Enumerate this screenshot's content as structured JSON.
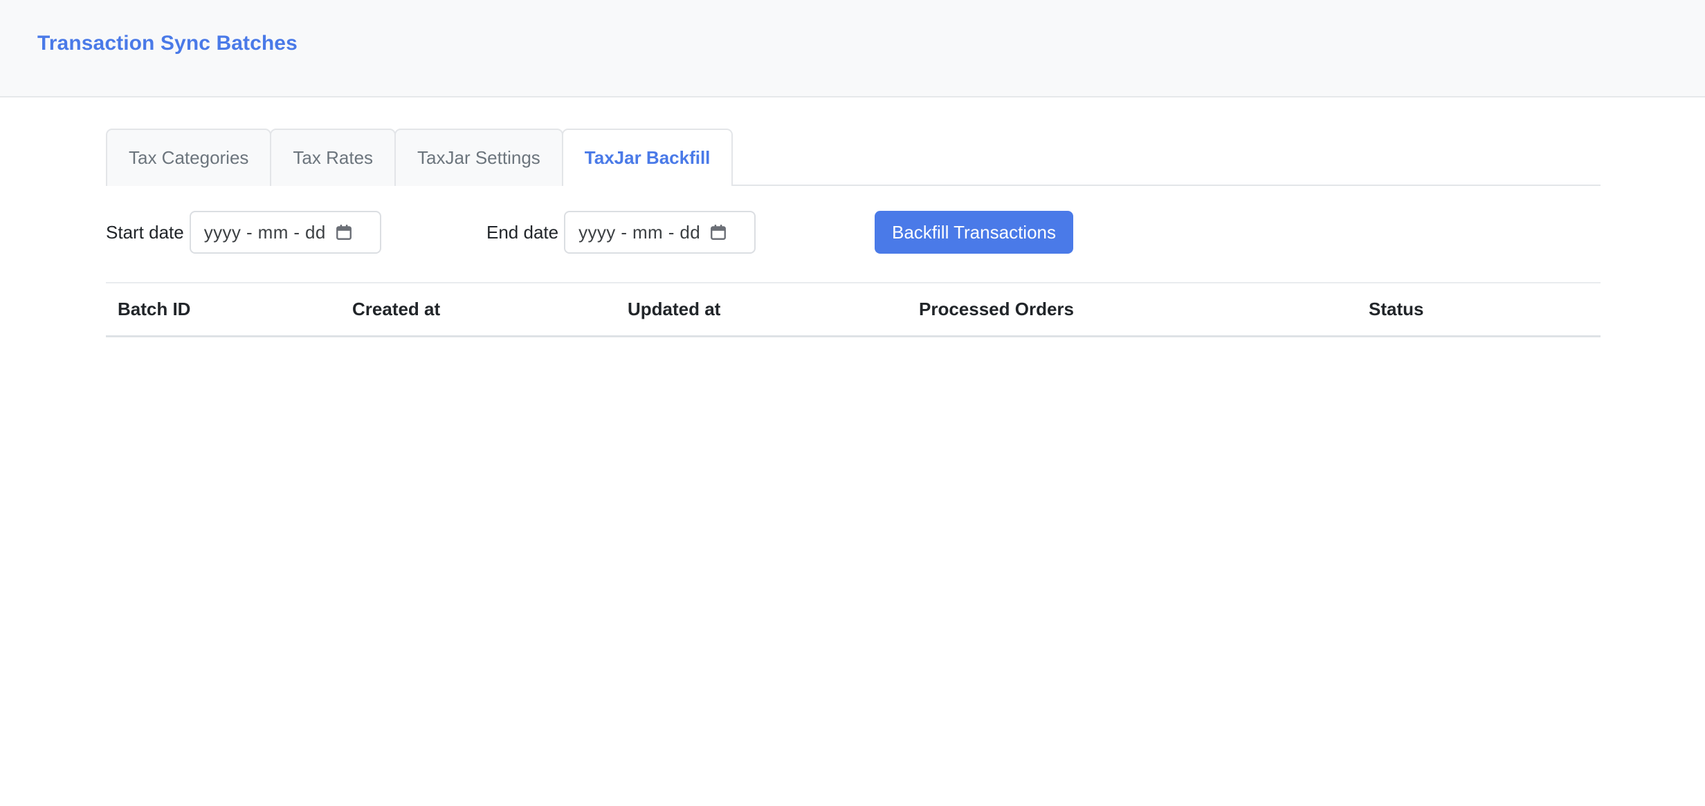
{
  "header": {
    "title": "Transaction Sync Batches"
  },
  "tabs": [
    {
      "label": "Tax Categories",
      "active": false,
      "name": "tab-tax-categories"
    },
    {
      "label": "Tax Rates",
      "active": false,
      "name": "tab-tax-rates"
    },
    {
      "label": "TaxJar Settings",
      "active": false,
      "name": "tab-taxjar-settings"
    },
    {
      "label": "TaxJar Backfill",
      "active": true,
      "name": "tab-taxjar-backfill"
    }
  ],
  "controls": {
    "start_date": {
      "label": "Start date",
      "value": "",
      "placeholder": "yyyy - mm - dd",
      "icon": "calendar-icon"
    },
    "end_date": {
      "label": "End date",
      "value": "",
      "placeholder": "yyyy - mm - dd",
      "icon": "calendar-icon"
    },
    "backfill_button": {
      "label": "Backfill Transactions"
    }
  },
  "table": {
    "columns": [
      "Batch ID",
      "Created at",
      "Updated at",
      "Processed Orders",
      "Status"
    ],
    "rows": []
  },
  "colors": {
    "accent": "#4a7ae8",
    "header_bg": "#f8f9fa",
    "tab_inactive_bg": "#f8f9fa",
    "tab_border": "#e3e5e8",
    "text_muted": "#6c757d",
    "text_default": "#212529",
    "table_border": "#dee2e6"
  }
}
